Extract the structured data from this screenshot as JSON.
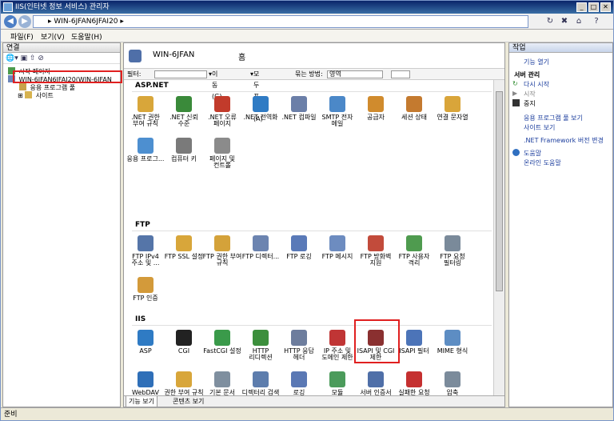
{
  "window": {
    "title": "IIS(인터넷 정보 서비스) 관리자"
  },
  "address": {
    "path": "▸ WIN-6JFAN6JFAI20 ▸"
  },
  "menu": [
    "파일(F)",
    "보기(V)",
    "도움말(H)"
  ],
  "connections": {
    "title": "연결",
    "tree": [
      {
        "label": "시작 페이지"
      },
      {
        "label": "WIN-6JFAN6JFAI20(WIN-6JFAN"
      },
      {
        "label": "응용 프로그램 풀"
      },
      {
        "label": "사이트"
      }
    ]
  },
  "center": {
    "host": "WIN-6JFAN",
    "home": "홈",
    "filter_label": "필터:",
    "go_label": "이동(G)",
    "show_all": "모두 표시(A)",
    "group_by": "묶는 방법:",
    "group_value": "영역",
    "groups": [
      {
        "name": "ASP.NET",
        "items": [
          {
            "label": ".NET 권한 부여 규칙",
            "icon": "lock-icon",
            "color": "#d8a63a"
          },
          {
            "label": ".NET 신뢰 수준",
            "icon": "globe-check-icon",
            "color": "#3a8a3a"
          },
          {
            "label": ".NET 오류 페이지",
            "icon": "error-page-icon",
            "color": "#c23b2b"
          },
          {
            "label": ".NET 전역화",
            "icon": "globe-icon",
            "color": "#2f7bc4"
          },
          {
            "label": ".NET 컴파일",
            "icon": "compile-icon",
            "color": "#6b7fa8"
          },
          {
            "label": "SMTP 전자 메일",
            "icon": "mail-icon",
            "color": "#4b88c8"
          },
          {
            "label": "공급자",
            "icon": "provider-icon",
            "color": "#d08b2d"
          },
          {
            "label": "세션 상태",
            "icon": "session-icon",
            "color": "#c47a2f"
          },
          {
            "label": "연결 문자열",
            "icon": "connection-string-icon",
            "color": "#d9a53a"
          },
          {
            "label": "응용 프로그...",
            "icon": "app-settings-icon",
            "color": "#4d8fd0"
          },
          {
            "label": "컴퓨터 키",
            "icon": "machine-key-icon",
            "color": "#7a7a7a"
          },
          {
            "label": "페이지 및 컨트롤",
            "icon": "pages-controls-icon",
            "color": "#8b8b8b"
          }
        ]
      },
      {
        "name": "FTP",
        "items": [
          {
            "label": "FTP IPv4 주소 및 ...",
            "icon": "ftp-ip-icon",
            "color": "#5575a8"
          },
          {
            "label": "FTP SSL 설정",
            "icon": "ftp-lock-icon",
            "color": "#d8a63a"
          },
          {
            "label": "FTP 권한 부여 규칙",
            "icon": "ftp-auth-icon",
            "color": "#d4a23a"
          },
          {
            "label": "FTP 디렉터...",
            "icon": "ftp-dir-icon",
            "color": "#6c84b0"
          },
          {
            "label": "FTP 로깅",
            "icon": "ftp-log-icon",
            "color": "#5a7ab8"
          },
          {
            "label": "FTP 메시지",
            "icon": "ftp-msg-icon",
            "color": "#6d8cc0"
          },
          {
            "label": "FTP 방화벽 지원",
            "icon": "ftp-firewall-icon",
            "color": "#c24b3b"
          },
          {
            "label": "FTP 사용자 격리",
            "icon": "ftp-user-icon",
            "color": "#4f9b4f"
          },
          {
            "label": "FTP 요청 필터링",
            "icon": "ftp-filter-icon",
            "color": "#7a8a9a"
          },
          {
            "label": "FTP 인증",
            "icon": "ftp-authn-icon",
            "color": "#d39a3a"
          }
        ]
      },
      {
        "name": "IIS",
        "items": [
          {
            "label": "ASP",
            "icon": "asp-icon",
            "color": "#2f7bc4"
          },
          {
            "label": "CGI",
            "icon": "cgi-icon",
            "color": "#222222"
          },
          {
            "label": "FastCGI 설정",
            "icon": "fastcgi-icon",
            "color": "#3a9a4a"
          },
          {
            "label": "HTTP 리디렉션",
            "icon": "redirect-icon",
            "color": "#3c8f3c"
          },
          {
            "label": "HTTP 응답 헤더",
            "icon": "response-header-icon",
            "color": "#6d7d9d"
          },
          {
            "label": "IP 주소 및 도메인 제한",
            "icon": "ip-restrict-icon",
            "color": "#c03535"
          },
          {
            "label": "ISAPI 및 CGI 제한",
            "icon": "isapi-cgi-icon",
            "color": "#8a3030"
          },
          {
            "label": "ISAPI 필터",
            "icon": "isapi-filter-icon",
            "color": "#4c74b8"
          },
          {
            "label": "MIME 형식",
            "icon": "mime-icon",
            "color": "#5d8dc3"
          },
          {
            "label": "WebDAV 제작 규칙",
            "icon": "webdav-icon",
            "color": "#2f6fb8"
          },
          {
            "label": "권한 부여 규칙",
            "icon": "authz-icon",
            "color": "#d8a63a"
          },
          {
            "label": "기본 문서",
            "icon": "default-doc-icon",
            "color": "#7f8f9f"
          },
          {
            "label": "디렉터리 검색",
            "icon": "dir-browse-icon",
            "color": "#5d7dad"
          },
          {
            "label": "로깅",
            "icon": "logging-icon",
            "color": "#5a78b4"
          },
          {
            "label": "모듈",
            "icon": "modules-icon",
            "color": "#4b9b5b"
          },
          {
            "label": "서버 인증서",
            "icon": "server-cert-icon",
            "color": "#4f6fa8"
          },
          {
            "label": "실패한 요청 추적 규칙",
            "icon": "failed-request-icon",
            "color": "#c53030"
          },
          {
            "label": "압축",
            "icon": "compression-icon",
            "color": "#7b8b9b"
          }
        ]
      }
    ],
    "view_tabs": [
      "기능 보기",
      "콘텐츠 보기"
    ]
  },
  "actions": {
    "title": "작업",
    "open_feature": "기능 열기",
    "server_manage": "서버 관리",
    "restart": "다시 시작",
    "start": "시작",
    "stop": "중지",
    "view_app_pools": "응용 프로그램 풀 보기",
    "view_sites": "사이트 보기",
    "net_version": ".NET Framework 버전 변경",
    "help": "도움말",
    "online_help": "온라인 도움말"
  },
  "status": {
    "text": "준비"
  }
}
